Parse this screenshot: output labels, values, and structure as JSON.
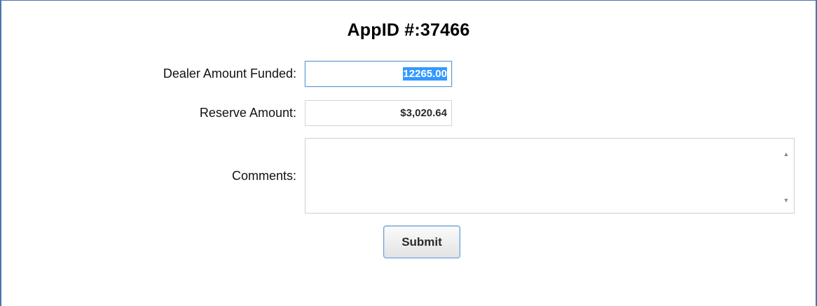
{
  "page": {
    "title": "AppID #:37466"
  },
  "form": {
    "dealer_amount_funded": {
      "label": "Dealer Amount Funded:",
      "value": "12265.00"
    },
    "reserve_amount": {
      "label": "Reserve Amount:",
      "value": "$3,020.64"
    },
    "comments": {
      "label": "Comments:",
      "value": ""
    },
    "submit_label": "Submit"
  },
  "icons": {
    "scroll_up": "scroll-up-arrow-icon",
    "scroll_down": "scroll-down-arrow-icon"
  },
  "colors": {
    "frame_border": "#4a75ad",
    "selection": "#3399ff",
    "button_border": "#6f9ccf"
  }
}
